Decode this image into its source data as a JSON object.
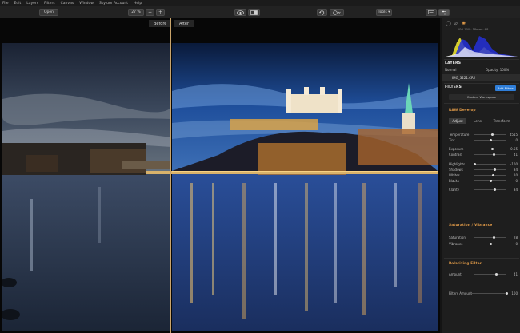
{
  "menu": [
    "File",
    "Edit",
    "Layers",
    "Filters",
    "Canvas",
    "Window",
    "Skylum Account",
    "Help"
  ],
  "toolbar": {
    "open_label": "Open",
    "zoom_label": "27 %",
    "zoom_out": "−",
    "zoom_in": "+",
    "tools_label": "Tools ▾"
  },
  "compare": {
    "before": "Before",
    "after": "After"
  },
  "panel": {
    "exif": "ISO 100 · 18mm · f/8",
    "layers_title": "LAYERS",
    "layer_name_label": "Normal",
    "opacity_label": "Opacity: 100%",
    "layer_file": "IMG_3221.CR2",
    "filters_title": "FILTERS",
    "add_filters_label": "Add Filters",
    "workspace_label": "Custom Workspace",
    "raw_title": "RAW Develop",
    "tabs": [
      "Adjust",
      "Lens",
      "Transform"
    ],
    "sliders": [
      {
        "label": "Temperature",
        "value": "4515",
        "pos": 0.55
      },
      {
        "label": "Tint",
        "value": "0",
        "pos": 0.5
      },
      {
        "label": "Exposure",
        "value": "0.55",
        "pos": 0.56
      },
      {
        "label": "Contrast",
        "value": "41",
        "pos": 0.62
      },
      {
        "label": "Highlights",
        "value": "-100",
        "pos": 0.0
      },
      {
        "label": "Shadows",
        "value": "34",
        "pos": 0.64
      },
      {
        "label": "Whites",
        "value": "20",
        "pos": 0.58
      },
      {
        "label": "Blacks",
        "value": "0",
        "pos": 0.5
      },
      {
        "label": "Clarity",
        "value": "34",
        "pos": 0.64
      }
    ],
    "sat_title": "Saturation / Vibrance",
    "sat_sliders": [
      {
        "label": "Saturation",
        "value": "28",
        "pos": 0.62
      },
      {
        "label": "Vibrance",
        "value": "0",
        "pos": 0.5
      }
    ],
    "polar_title": "Polarizing Filter",
    "polar_sliders": [
      {
        "label": "Amount",
        "value": "41",
        "pos": 0.68
      }
    ],
    "filter_amount_label": "Filters Amount",
    "filter_amount_value": "100",
    "filter_amount_pos": 1.0
  },
  "colors": {
    "accent": "#e09a48",
    "split": "#c9a46b",
    "add_filters": "#2f7ed8"
  }
}
